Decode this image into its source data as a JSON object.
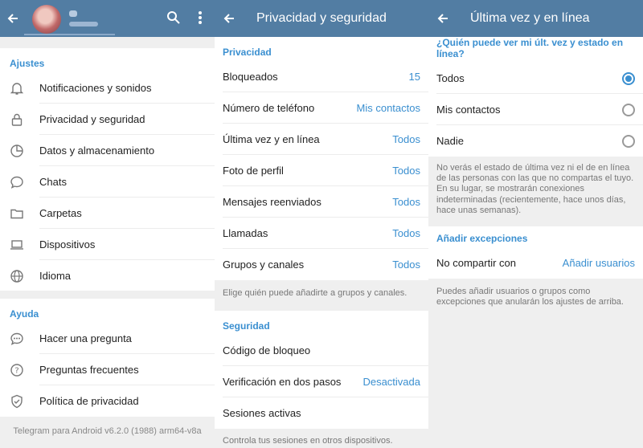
{
  "panel1": {
    "sections": [
      {
        "title": "Ajustes",
        "items": [
          {
            "icon": "bell-icon",
            "label": "Notificaciones y sonidos"
          },
          {
            "icon": "lock-icon",
            "label": "Privacidad y seguridad"
          },
          {
            "icon": "clock-icon",
            "label": "Datos y almacenamiento"
          },
          {
            "icon": "chat-bubble-icon",
            "label": "Chats"
          },
          {
            "icon": "folder-icon",
            "label": "Carpetas"
          },
          {
            "icon": "laptop-icon",
            "label": "Dispositivos"
          },
          {
            "icon": "globe-icon",
            "label": "Idioma"
          }
        ]
      },
      {
        "title": "Ayuda",
        "items": [
          {
            "icon": "chat-dots-icon",
            "label": "Hacer una pregunta"
          },
          {
            "icon": "question-circle-icon",
            "label": "Preguntas frecuentes"
          },
          {
            "icon": "shield-check-icon",
            "label": "Política de privacidad"
          }
        ]
      }
    ],
    "footer": "Telegram para Android v6.2.0 (1988) arm64-v8a"
  },
  "panel2": {
    "title": "Privacidad y seguridad",
    "privacy": {
      "title": "Privacidad",
      "rows": [
        {
          "label": "Bloqueados",
          "value": "15"
        },
        {
          "label": "Número de teléfono",
          "value": "Mis contactos"
        },
        {
          "label": "Última vez y en línea",
          "value": "Todos"
        },
        {
          "label": "Foto de perfil",
          "value": "Todos"
        },
        {
          "label": "Mensajes reenviados",
          "value": "Todos"
        },
        {
          "label": "Llamadas",
          "value": "Todos"
        },
        {
          "label": "Grupos y canales",
          "value": "Todos"
        }
      ],
      "note": "Elige quién puede añadirte a grupos y canales."
    },
    "security": {
      "title": "Seguridad",
      "rows": [
        {
          "label": "Código de bloqueo",
          "value": ""
        },
        {
          "label": "Verificación en dos pasos",
          "value": "Desactivada"
        },
        {
          "label": "Sesiones activas",
          "value": ""
        }
      ],
      "note": "Controla tus sesiones en otros dispositivos."
    }
  },
  "panel3": {
    "title": "Última vez y en línea",
    "question": "¿Quién puede ver mi últ. vez y estado en línea?",
    "options": [
      {
        "label": "Todos",
        "selected": true
      },
      {
        "label": "Mis contactos",
        "selected": false
      },
      {
        "label": "Nadie",
        "selected": false
      }
    ],
    "note": "No verás el estado de última vez ni el de en línea de las personas con las que no compartas el tuyo. En su lugar, se mostrarán conexiones indeterminadas (recientemente, hace unos días, hace unas semanas).",
    "exceptions_title": "Añadir excepciones",
    "exception_row": {
      "label": "No compartir con",
      "value": "Añadir usuarios"
    },
    "exceptions_note": "Puedes añadir usuarios o grupos como excepciones que anularán los ajustes de arriba."
  },
  "colors": {
    "appbar": "#527da3",
    "accent": "#3a8fd0"
  }
}
